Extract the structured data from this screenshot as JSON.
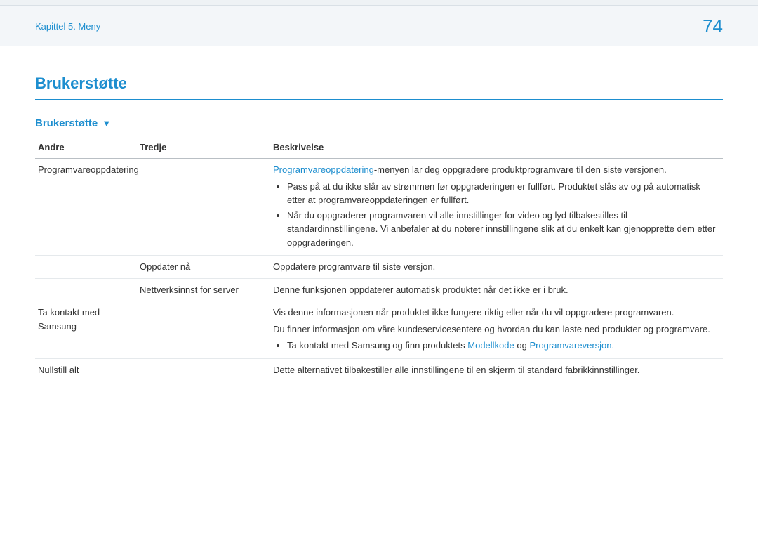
{
  "header": {
    "chapter": "Kapittel 5. Meny",
    "page_number": "74"
  },
  "section": {
    "title": "Brukerstøtte",
    "subtitle": "Brukerstøtte"
  },
  "table": {
    "headers": {
      "andre": "Andre",
      "tredje": "Tredje",
      "beskrivelse": "Beskrivelse"
    },
    "rows": {
      "r1": {
        "andre": "Programvareoppdatering",
        "desc_prefix": "Programvareoppdatering",
        "desc_after": "-menyen lar deg oppgradere produktprogramvare til den siste versjonen.",
        "bullet1": "Pass på at du ikke slår av strømmen før oppgraderingen er fullført. Produktet slås av og på automatisk etter at programvareoppdateringen er fullført.",
        "bullet2": "Når du oppgraderer programvaren vil alle innstillinger for video og lyd tilbakestilles til standardinnstillingene. Vi anbefaler at du noterer innstillingene slik at du enkelt kan gjenopprette dem etter oppgraderingen."
      },
      "r2": {
        "tredje": "Oppdater nå",
        "desc": "Oppdatere programvare til siste versjon."
      },
      "r3": {
        "tredje": "Nettverksinnst for server",
        "desc": "Denne funksjonen oppdaterer automatisk produktet når det ikke er i bruk."
      },
      "r4": {
        "andre": "Ta kontakt med Samsung",
        "line1": "Vis denne informasjonen når produktet ikke fungere riktig eller når du vil oppgradere programvaren.",
        "line2": "Du finner informasjon om våre kundeservicesentere og hvordan du kan laste ned produkter og programvare.",
        "bullet_pre": "Ta kontakt med Samsung og finn produktets ",
        "bullet_link1": "Modellkode",
        "bullet_mid": " og ",
        "bullet_link2": "Programvareversjon."
      },
      "r5": {
        "andre": "Nullstill alt",
        "desc": "Dette alternativet tilbakestiller alle innstillingene til en skjerm til standard fabrikkinnstillinger."
      }
    }
  }
}
